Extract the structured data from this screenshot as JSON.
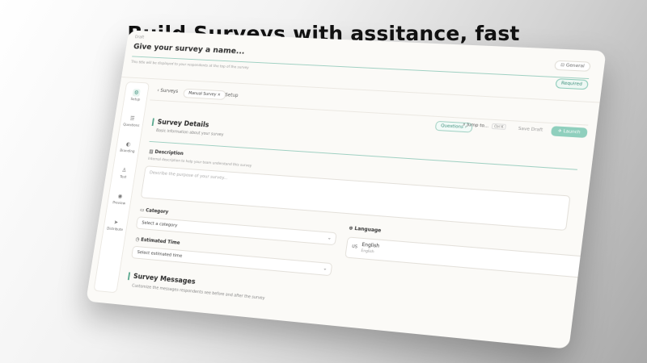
{
  "headline": "Build Surveys with assitance, fast",
  "topbar": {
    "status": "Draft",
    "name_placeholder": "Give your survey a name...",
    "name_hint": "This title will be displayed to your respondents at the top of the survey",
    "general_label": "General",
    "required_label": "Required"
  },
  "sidebar": {
    "items": [
      {
        "label": "Setup",
        "icon": "setup-icon"
      },
      {
        "label": "Questions",
        "icon": "questions-icon"
      },
      {
        "label": "Branding",
        "icon": "branding-icon"
      },
      {
        "label": "Test",
        "icon": "test-icon"
      },
      {
        "label": "Preview",
        "icon": "preview-icon"
      },
      {
        "label": "Distribute",
        "icon": "distribute-icon"
      }
    ]
  },
  "breadcrumb": {
    "back": "Surveys",
    "pill": "Manual Survey",
    "current": "Setup"
  },
  "toolbar": {
    "questions": "Questions",
    "jump": "Jump to...",
    "jump_kbd": "Ctrl K",
    "save": "Save Draft",
    "launch": "Launch"
  },
  "details": {
    "title": "Survey Details",
    "subtitle": "Basic information about your survey",
    "description_label": "Description",
    "description_hint": "Internal description to help your team understand this survey",
    "description_placeholder": "Describe the purpose of your survey...",
    "category_label": "Category",
    "category_value": "Select a category",
    "time_label": "Estimated Time",
    "time_value": "Select estimated time",
    "language_label": "Language",
    "language_code": "US",
    "language_name": "English",
    "language_native": "English"
  },
  "messages": {
    "title": "Survey Messages",
    "subtitle": "Customize the messages respondents see before and after the survey"
  },
  "colors": {
    "accent": "#5aa98f",
    "launch": "#8fcfbd"
  }
}
